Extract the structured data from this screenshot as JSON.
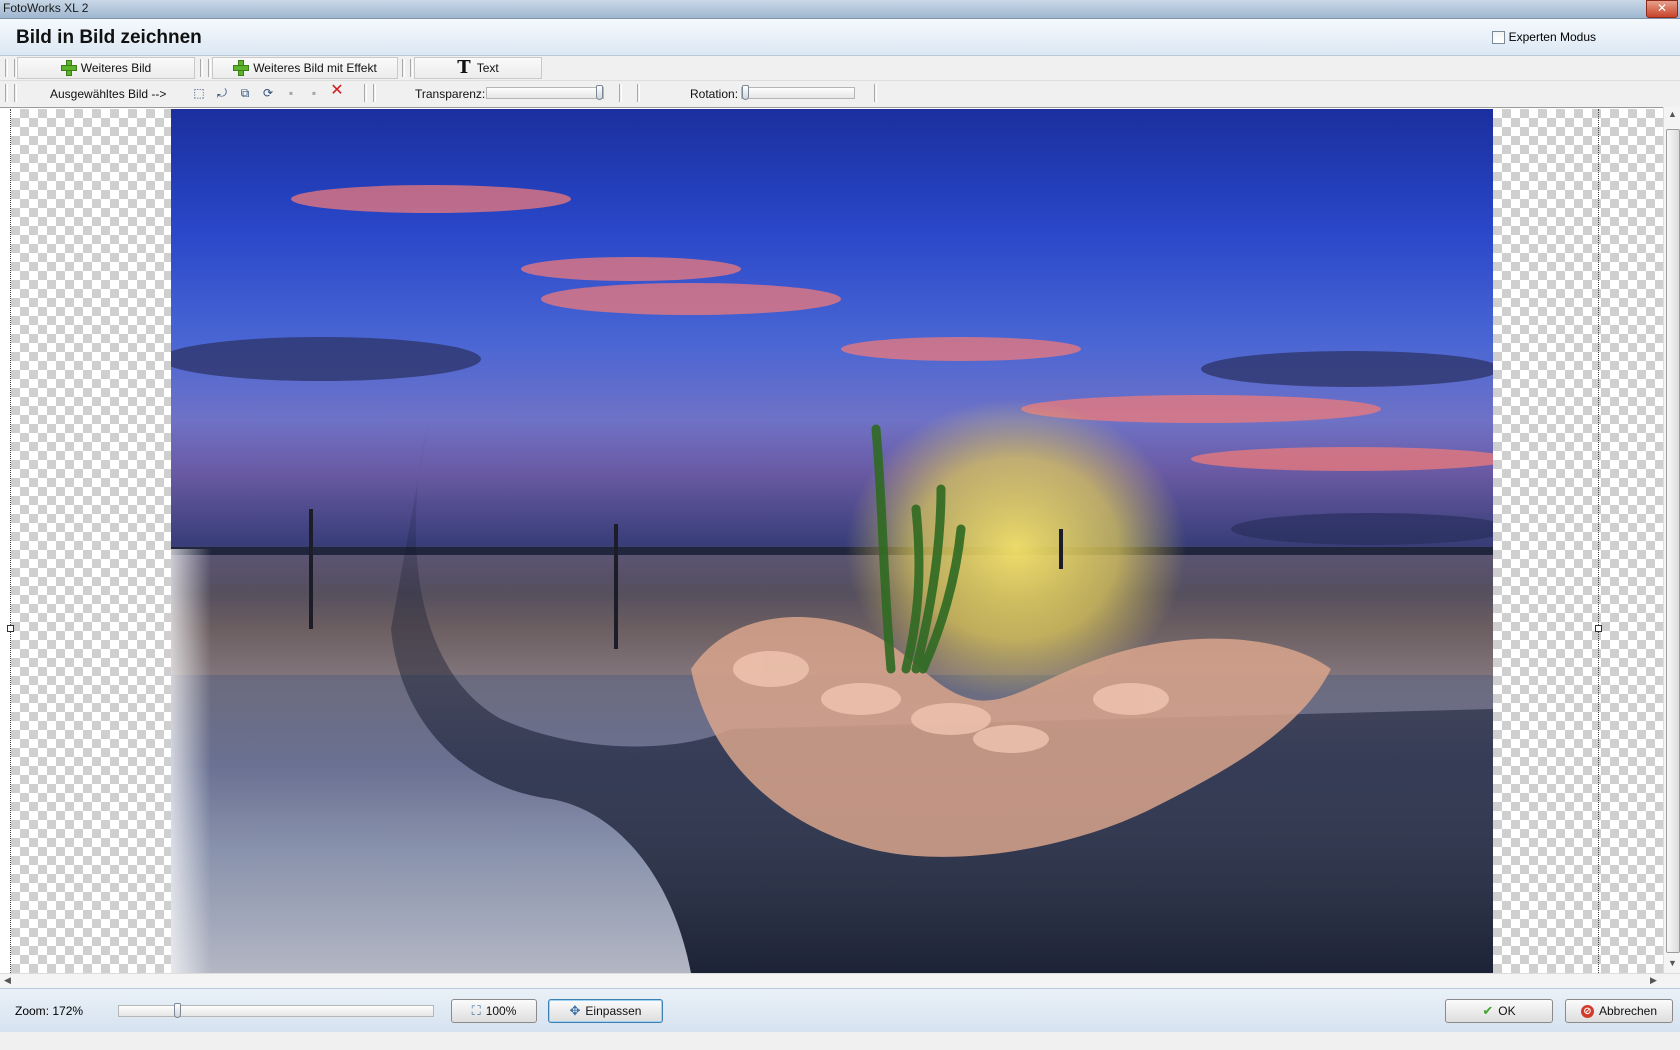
{
  "window": {
    "title": "FotoWorks XL 2",
    "close_glyph": "✕"
  },
  "header": {
    "title": "Bild in Bild zeichnen",
    "expert_mode_label": "Experten Modus",
    "expert_mode_checked": false
  },
  "toolbar": {
    "add_image_label": "Weiteres Bild",
    "add_image_effect_label": "Weiteres Bild mit Effekt",
    "text_label": "Text",
    "selected_image_label": "Ausgewähltes Bild -->",
    "tools": [
      {
        "icon": "crop-icon",
        "glyph": "⬚"
      },
      {
        "icon": "flip-icon",
        "glyph": "⤾"
      },
      {
        "icon": "mirror-icon",
        "glyph": "⧉"
      },
      {
        "icon": "rotate-icon",
        "glyph": "⟳"
      },
      {
        "icon": "layer-down-icon",
        "glyph": "▪"
      },
      {
        "icon": "layer-up-icon",
        "glyph": "▪"
      },
      {
        "icon": "delete-icon",
        "glyph": "✕"
      }
    ],
    "transparency_label": "Transparenz:",
    "transparency_value": 1.0,
    "rotation_label": "Rotation:",
    "rotation_value": 0.0
  },
  "footer": {
    "zoom_label": "Zoom: 172%",
    "zoom_slider_value": 0.18,
    "btn_100_label": "100%",
    "btn_fit_label": "Einpassen",
    "btn_ok_label": "OK",
    "btn_cancel_label": "Abbrechen"
  },
  "colors": {
    "accent": "#3c7fb1",
    "delete": "#d21a1a",
    "ok": "#43a528"
  }
}
